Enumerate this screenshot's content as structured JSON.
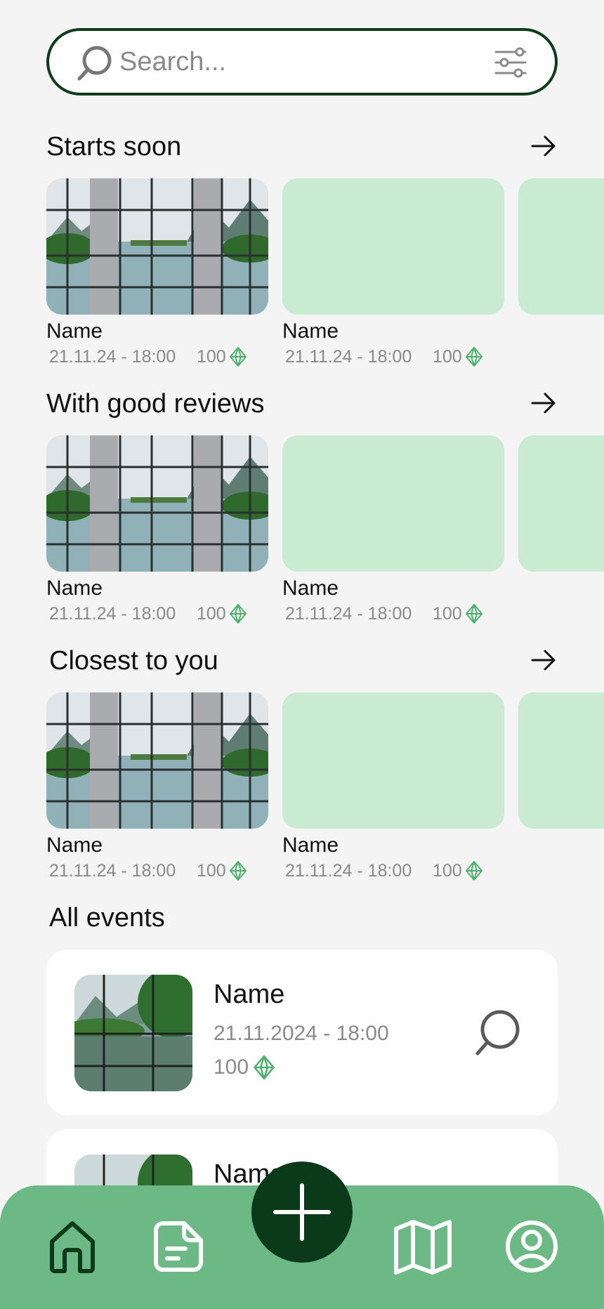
{
  "search": {
    "placeholder": "Search...",
    "value": ""
  },
  "sections": [
    {
      "title": "Starts soon",
      "cards": [
        {
          "name": "Name",
          "date": "21.11.24 - 18:00",
          "price": "100",
          "image": "window-lake"
        },
        {
          "name": "Name",
          "date": "21.11.24 - 18:00",
          "price": "100",
          "image": "placeholder"
        },
        {
          "name": "",
          "date": "",
          "price": "",
          "image": "placeholder"
        }
      ]
    },
    {
      "title": "With good reviews",
      "cards": [
        {
          "name": "Name",
          "date": "21.11.24 - 18:00",
          "price": "100",
          "image": "window-lake"
        },
        {
          "name": "Name",
          "date": "21.11.24 - 18:00",
          "price": "100",
          "image": "placeholder"
        },
        {
          "name": "",
          "date": "",
          "price": "",
          "image": "placeholder"
        }
      ]
    },
    {
      "title": "Closest to you",
      "cards": [
        {
          "name": "Name",
          "date": "21.11.24 - 18:00",
          "price": "100",
          "image": "window-lake"
        },
        {
          "name": "Name",
          "date": "21.11.24 - 18:00",
          "price": "100",
          "image": "placeholder"
        },
        {
          "name": "",
          "date": "",
          "price": "",
          "image": "placeholder"
        }
      ]
    }
  ],
  "all_events": {
    "title": "All events",
    "items": [
      {
        "name": "Name",
        "date": "21.11.2024 - 18:00",
        "price": "100"
      },
      {
        "name": "Name",
        "date": "",
        "price": ""
      }
    ]
  },
  "nav": {
    "items": [
      "home-icon",
      "notes-icon",
      "add-icon",
      "map-icon",
      "profile-icon"
    ],
    "active": "home-icon"
  },
  "colors": {
    "accent_dark": "#0b3a1b",
    "nav_green": "#6cb985",
    "placeholder_green": "#c8ebd2",
    "diamond_green": "#4caf6d",
    "background": "#f4f4f4"
  }
}
